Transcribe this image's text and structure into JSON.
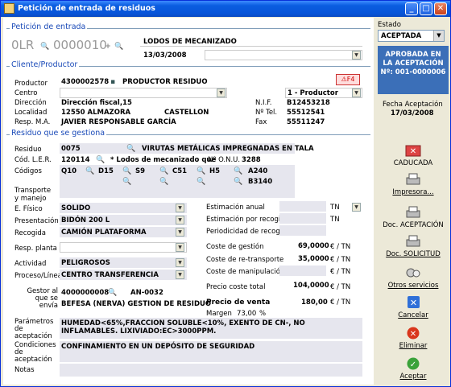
{
  "window": {
    "title": "Petición de entrada de residuos"
  },
  "peticion": {
    "section": "Petición de entrada",
    "code_prefix": "0LR",
    "code_number": "0000010",
    "description": "LODOS DE MECANIZADO",
    "date": "13/03/2008"
  },
  "cliente": {
    "section": "Cliente/Productor",
    "productor_label": "Productor",
    "productor_code": "4300002578",
    "productor_name": "PRODUCTOR RESIDUO",
    "centro_label": "Centro",
    "centro_value": "1 - Productor",
    "direccion_label": "Dirección",
    "direccion_value": "Dirección fiscal,15",
    "nif_label": "N.I.F.",
    "nif_value": "B12453218",
    "localidad_label": "Localidad",
    "localidad_value": "12550 ALMAZORA",
    "provincia_value": "CASTELLON",
    "tel_label": "Nº Tel.",
    "tel_value": "55512541",
    "resp_label": "Resp. M.A.",
    "resp_value": "JAVIER RESPONSABLE GARCÍA",
    "fax_label": "Fax",
    "fax_value": "55511247",
    "f4_label": "F4"
  },
  "residuo": {
    "section": "Residuo que se gestiona",
    "residuo_label": "Residuo",
    "residuo_code": "0075",
    "residuo_name": "VIRUTAS METÁLICAS IMPREGNADAS EN TALA",
    "ler_label": "Cód. L.E.R.",
    "ler_value": "120114",
    "ler_desc": "* Lodos de mecanizado que",
    "onu_label": "Nº O.N.U.",
    "onu_value": "3288",
    "codigos_label": "Códigos",
    "codigos": [
      "Q10",
      "D15",
      "S9",
      "C51",
      "H5",
      "A240",
      "B3140"
    ],
    "transporte_label": "Transporte y manejo",
    "efisico_label": "E. Físico",
    "efisico_value": "SOLIDO",
    "presentacion_label": "Presentación",
    "presentacion_value": "BIDÓN 200 L",
    "recogida_label": "Recogida",
    "recogida_value": "CAMIÓN PLATAFORMA",
    "resp_planta_label": "Resp. planta",
    "actividad_label": "Actividad",
    "actividad_value": "PELIGROSOS",
    "proceso_label": "Proceso/Línea",
    "proceso_value": "CENTRO TRANSFERENCIA",
    "gestor_label": "Gestor al que se envía",
    "gestor_code": "4000000008",
    "gestor_ref": "AN-0032",
    "gestor_name": "BEFESA (NERVA) GESTION DE RESIDUO",
    "est_anual_label": "Estimación anual",
    "est_anual_unit": "TN",
    "est_recogida_label": "Estimación por recogida",
    "est_recogida_unit": "TN",
    "periodicidad_label": "Periodicidad de recogida",
    "coste_gestion_label": "Coste de gestión",
    "coste_gestion_value": "69,0000",
    "coste_retransporte_label": "Coste de re-transporte",
    "coste_retransporte_value": "35,0000",
    "coste_manip_label": "Coste de manipulación",
    "unit_eur_tn": "€ / TN",
    "precio_coste_label": "Precio coste total",
    "precio_coste_value": "104,0000",
    "precio_venta_label": "Precio de venta",
    "precio_venta_value": "180,00",
    "margen_label": "Margen",
    "margen_value": "73,00",
    "margen_unit": "%",
    "param_label": "Parámetros de aceptación",
    "param_value": "HUMEDAD<65%,FRACCION SOLUBLE<10%, EXENTO DE CN-, NO INFLAMABLES. LIXIVIADO:EC>3000PPM.",
    "cond_label": "Condiciones de aceptación",
    "cond_value": "CONFINAMIENTO EN UN DEPÓSITO DE SEGURIDAD",
    "notas_label": "Notas"
  },
  "side": {
    "estado_label": "Estado",
    "estado_value": "ACEPTADA",
    "status_line1": "APROBADA EN",
    "status_line2": "LA ACEPTACIÓN",
    "status_line3": "Nº: 001-0000006",
    "fecha_label": "Fecha Aceptación",
    "fecha_value": "17/03/2008",
    "caducada": "CADUCADA",
    "impresora": "Impresora...",
    "doc_aceptacion": "Doc. ACEPTACIÓN",
    "doc_solicitud": "Doc. SOLICITUD",
    "otros": "Otros servicios",
    "cancelar": "Cancelar",
    "eliminar": "Eliminar",
    "aceptar": "Aceptar"
  }
}
